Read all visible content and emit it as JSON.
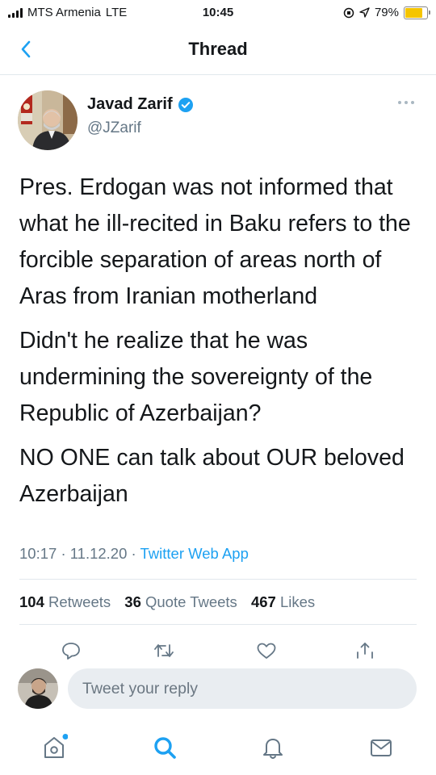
{
  "status_bar": {
    "carrier": "MTS Armenia",
    "network": "LTE",
    "time": "10:45",
    "battery_percent": "79%",
    "battery_level": 0.79,
    "icons": [
      "signal-bars-icon",
      "orientation-lock-icon",
      "location-arrow-icon",
      "battery-icon"
    ]
  },
  "nav": {
    "title": "Thread",
    "back_icon": "chevron-left-icon"
  },
  "tweet": {
    "author_name": "Javad Zarif",
    "verified": true,
    "handle": "@JZarif",
    "paragraphs": [
      "Pres. Erdogan was not informed that what he ill-recited in Baku refers to the forcible separation of areas north of Aras from Iranian motherland",
      "Didn't he realize that he was undermining the sovereignty of the Republic of Azerbaijan?",
      "NO ONE can talk about OUR beloved Azerbaijan"
    ],
    "time": "10:17",
    "date": "11.12.20",
    "source": "Twitter Web App",
    "separator": "·"
  },
  "stats": {
    "retweets_count": "104",
    "retweets_label": "Retweets",
    "quotes_count": "36",
    "quotes_label": "Quote Tweets",
    "likes_count": "467",
    "likes_label": "Likes"
  },
  "actions": [
    "reply-icon",
    "retweet-icon",
    "like-icon",
    "share-icon"
  ],
  "reply": {
    "placeholder": "Tweet your reply"
  },
  "tabbar": [
    "home-icon",
    "search-icon",
    "notifications-icon",
    "messages-icon"
  ],
  "colors": {
    "accent": "#1da1f2",
    "secondary_text": "#657786",
    "divider": "#e1e8ed",
    "battery": "#f5c500"
  }
}
